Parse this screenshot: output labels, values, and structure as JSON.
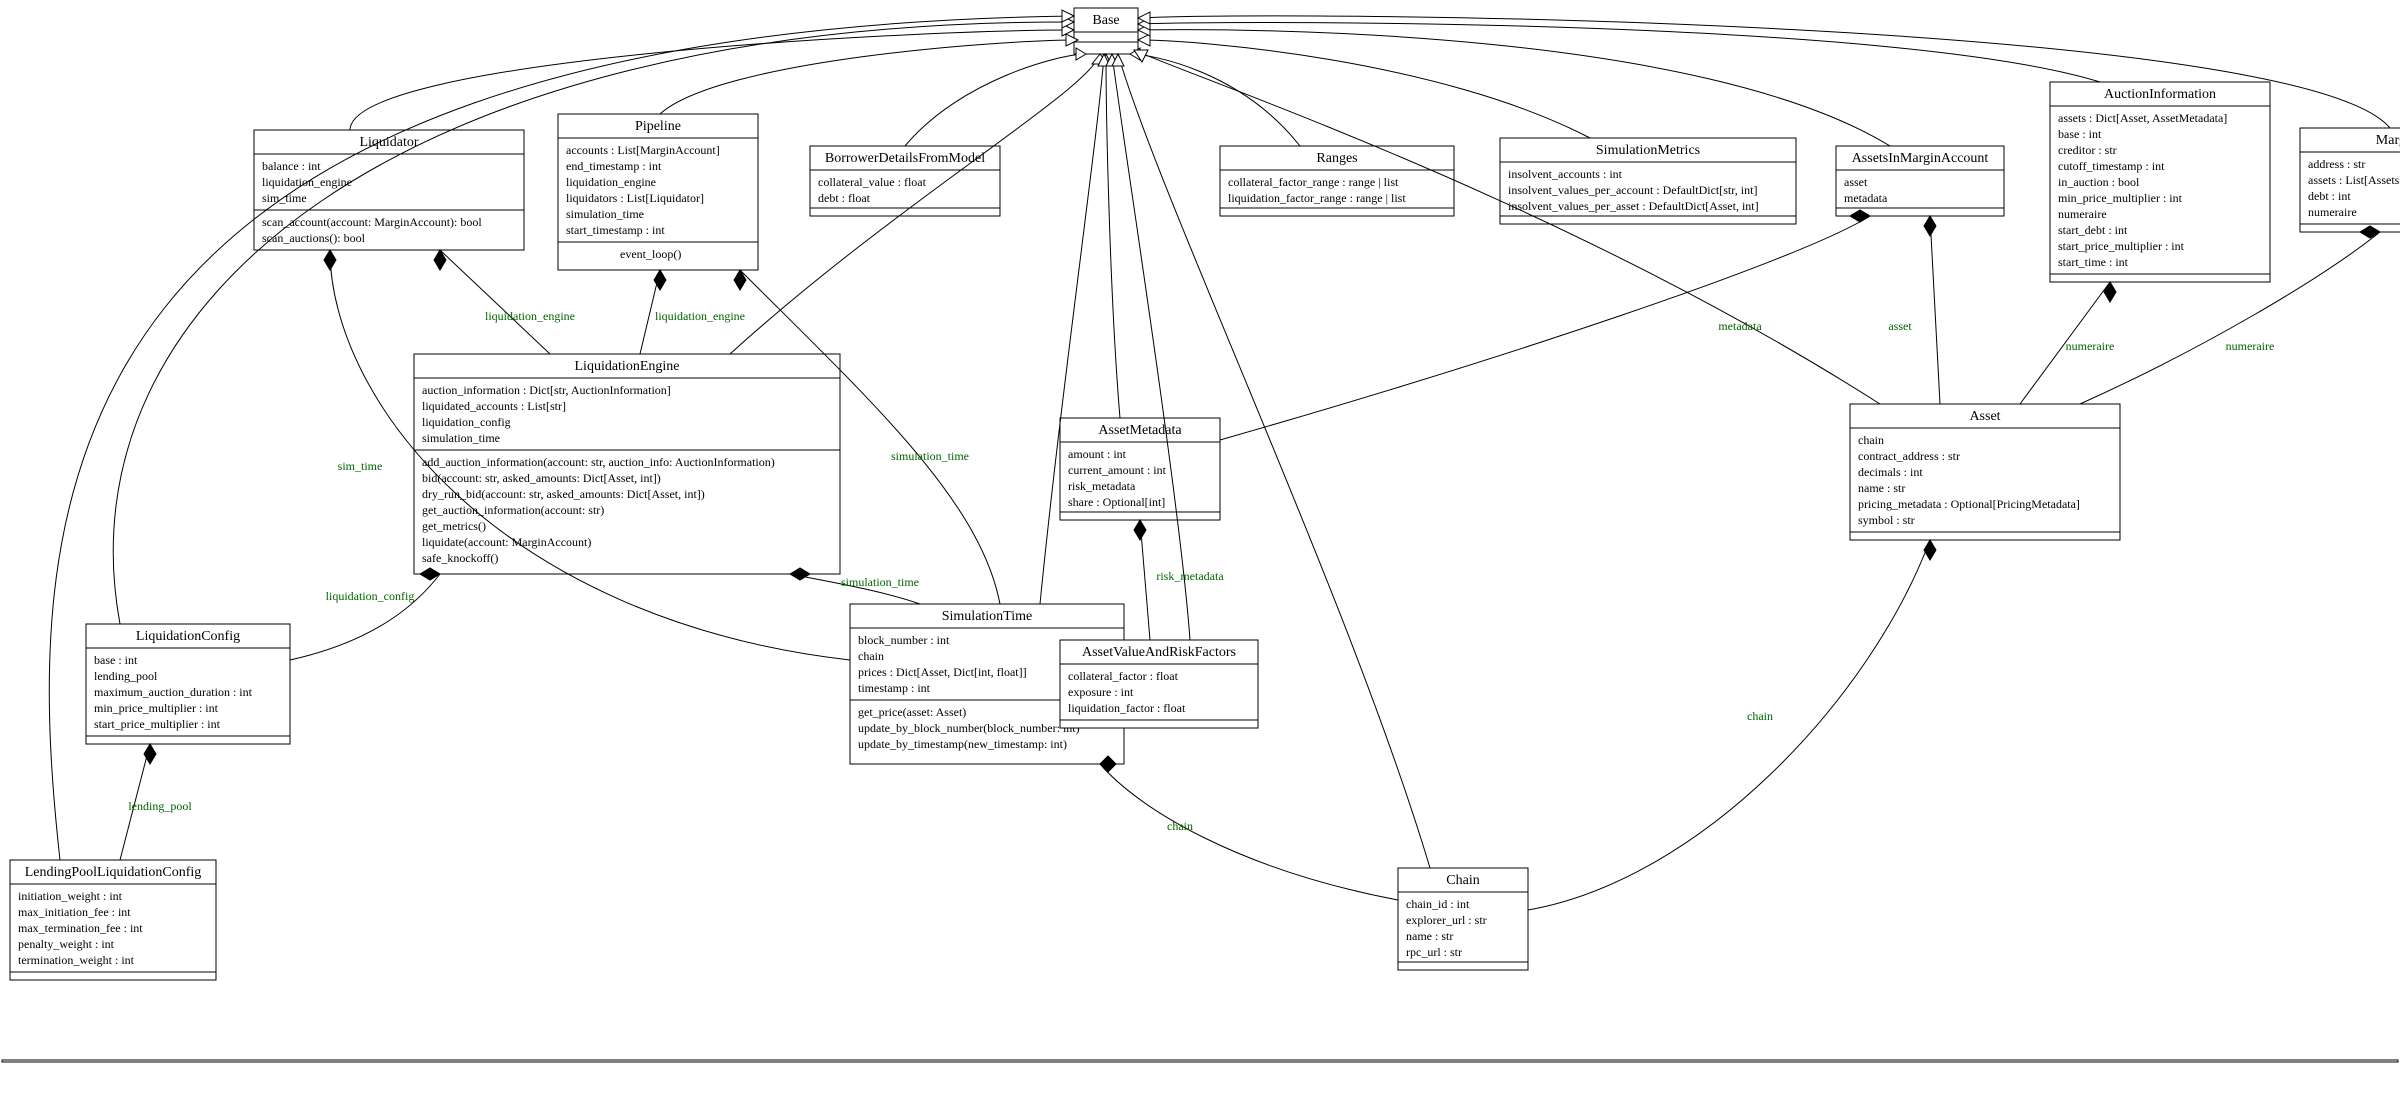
{
  "diagram": {
    "classes": {
      "Base": {
        "name": "Base",
        "attrs": [],
        "methods": []
      },
      "Liquidator": {
        "name": "Liquidator",
        "attrs": [
          "balance : int",
          "liquidation_engine",
          "sim_time"
        ],
        "methods": [
          "scan_account(account: MarginAccount): bool",
          "scan_auctions(): bool"
        ]
      },
      "Pipeline": {
        "name": "Pipeline",
        "attrs": [
          "accounts : List[MarginAccount]",
          "end_timestamp : int",
          "liquidation_engine",
          "liquidators : List[Liquidator]",
          "simulation_time",
          "start_timestamp : int"
        ],
        "methods": [
          "event_loop()"
        ]
      },
      "BorrowerDetailsFromModel": {
        "name": "BorrowerDetailsFromModel",
        "attrs": [
          "collateral_value : float",
          "debt : float"
        ],
        "methods": []
      },
      "Ranges": {
        "name": "Ranges",
        "attrs": [
          "collateral_factor_range : range | list",
          "liquidation_factor_range : range | list"
        ],
        "methods": []
      },
      "SimulationMetrics": {
        "name": "SimulationMetrics",
        "attrs": [
          "insolvent_accounts : int",
          "insolvent_values_per_account : DefaultDict[str, int]",
          "insolvent_values_per_asset : DefaultDict[Asset, int]"
        ],
        "methods": []
      },
      "AssetsInMarginAccount": {
        "name": "AssetsInMarginAccount",
        "attrs": [
          "asset",
          "metadata"
        ],
        "methods": []
      },
      "AuctionInformation": {
        "name": "AuctionInformation",
        "attrs": [
          "assets : Dict[Asset, AssetMetadata]",
          "base : int",
          "creditor : str",
          "cutoff_timestamp : int",
          "in_auction : bool",
          "min_price_multiplier : int",
          "numeraire",
          "start_debt : int",
          "start_price_multiplier : int",
          "start_time : int"
        ],
        "methods": []
      },
      "MarginAccount": {
        "name": "MarginAccount",
        "attrs": [
          "address : str",
          "assets : List[AssetsInMarginAccount]",
          "debt : int",
          "numeraire"
        ],
        "methods": []
      },
      "LiquidationEngine": {
        "name": "LiquidationEngine",
        "attrs": [
          "auction_information : Dict[str, AuctionInformation]",
          "liquidated_accounts : List[str]",
          "liquidation_config",
          "simulation_time"
        ],
        "methods": [
          "add_auction_information(account: str, auction_info: AuctionInformation)",
          "bid(account: str, asked_amounts: Dict[Asset, int])",
          "dry_run_bid(account: str, asked_amounts: Dict[Asset, int])",
          "get_auction_information(account: str)",
          "get_metrics()",
          "liquidate(account: MarginAccount)",
          "safe_knockoff()"
        ]
      },
      "AssetMetadata": {
        "name": "AssetMetadata",
        "attrs": [
          "amount : int",
          "current_amount : int",
          "risk_metadata",
          "share : Optional[int]"
        ],
        "methods": []
      },
      "Asset": {
        "name": "Asset",
        "attrs": [
          "chain",
          "contract_address : str",
          "decimals : int",
          "name : str",
          "pricing_metadata : Optional[PricingMetadata]",
          "symbol : str"
        ],
        "methods": []
      },
      "LiquidationConfig": {
        "name": "LiquidationConfig",
        "attrs": [
          "base : int",
          "lending_pool",
          "maximum_auction_duration : int",
          "min_price_multiplier : int",
          "start_price_multiplier : int"
        ],
        "methods": []
      },
      "SimulationTime": {
        "name": "SimulationTime",
        "attrs": [
          "block_number : int",
          "chain",
          "prices : Dict[Asset, Dict[int, float]]",
          "timestamp : int"
        ],
        "methods": [
          "get_price(asset: Asset)",
          "update_by_block_number(block_number: int)",
          "update_by_timestamp(new_timestamp: int)"
        ]
      },
      "AssetValueAndRiskFactors": {
        "name": "AssetValueAndRiskFactors",
        "attrs": [
          "collateral_factor : float",
          "exposure : int",
          "liquidation_factor : float"
        ],
        "methods": []
      },
      "LendingPoolLiquidationConfig": {
        "name": "LendingPoolLiquidationConfig",
        "attrs": [
          "initiation_weight : int",
          "max_initiation_fee : int",
          "max_termination_fee : int",
          "penalty_weight : int",
          "termination_weight : int"
        ],
        "methods": []
      },
      "Chain": {
        "name": "Chain",
        "attrs": [
          "chain_id : int",
          "explorer_url : str",
          "name : str",
          "rpc_url : str"
        ],
        "methods": []
      }
    },
    "labels": {
      "liquidation_engine": "liquidation_engine",
      "sim_time": "sim_time",
      "simulation_time": "simulation_time",
      "liquidation_config": "liquidation_config",
      "lending_pool": "lending_pool",
      "risk_metadata": "risk_metadata",
      "metadata": "metadata",
      "asset": "asset",
      "numeraire": "numeraire",
      "chain": "chain"
    }
  }
}
